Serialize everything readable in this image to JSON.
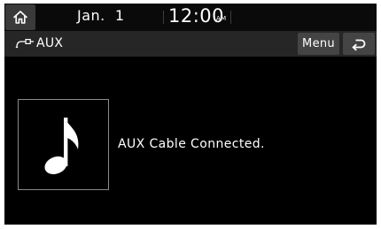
{
  "status_bar": {
    "home_icon": "home-icon",
    "date": "Jan.  1",
    "time": "12:00",
    "ampm": "AM"
  },
  "title_bar": {
    "source_icon": "aux-cable-icon",
    "title": "AUX",
    "menu_label": "Menu",
    "back_icon": "back-arrow-icon"
  },
  "content": {
    "album_art_icon": "music-note-icon",
    "message": "AUX Cable Connected."
  },
  "colors": {
    "screen_background": "#000000",
    "title_bar_background": "#262626",
    "button_background": "#444444",
    "text": "#ffffff"
  }
}
